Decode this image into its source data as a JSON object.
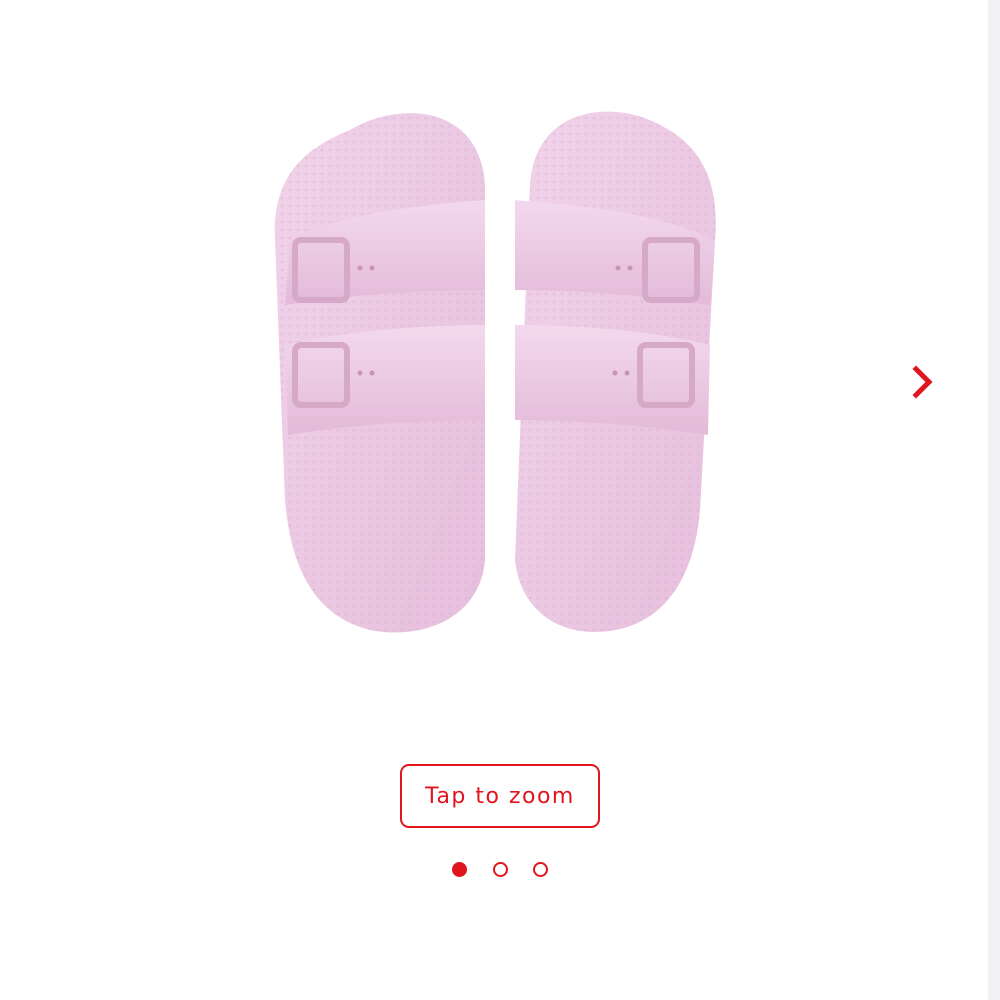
{
  "gallery": {
    "image_alt": "sandals",
    "next_icon": "chevron-right-icon",
    "zoom_label": "Tap to zoom",
    "slide_count": 3,
    "active_slide": 1
  },
  "colors": {
    "accent": "#e0161e",
    "product": "#ecc8e3"
  }
}
